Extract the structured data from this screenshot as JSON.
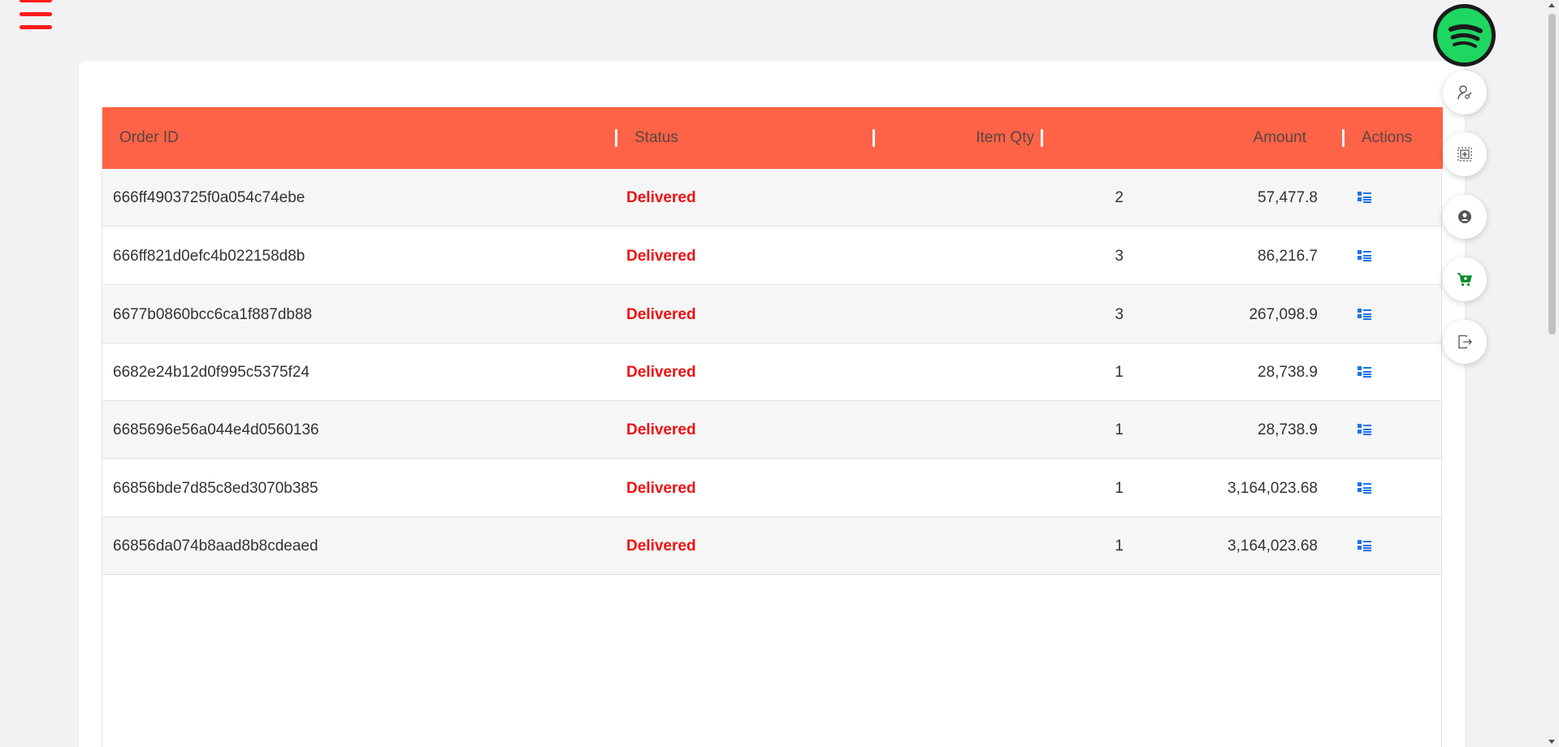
{
  "menu": {
    "icon": "hamburger-menu-icon"
  },
  "table": {
    "headers": {
      "order_id": "Order ID",
      "status": "Status",
      "item_qty": "Item Qty",
      "amount": "Amount",
      "actions": "Actions"
    },
    "rows": [
      {
        "order_id": "666ff4903725f0a054c74ebe",
        "status": "Delivered",
        "qty": "2",
        "amount": "57,477.8"
      },
      {
        "order_id": "666ff821d0efc4b022158d8b",
        "status": "Delivered",
        "qty": "3",
        "amount": "86,216.7"
      },
      {
        "order_id": "6677b0860bcc6ca1f887db88",
        "status": "Delivered",
        "qty": "3",
        "amount": "267,098.9"
      },
      {
        "order_id": "6682e24b12d0f995c5375f24",
        "status": "Delivered",
        "qty": "1",
        "amount": "28,738.9"
      },
      {
        "order_id": "6685696e56a044e4d0560136",
        "status": "Delivered",
        "qty": "1",
        "amount": "28,738.9"
      },
      {
        "order_id": "66856bde7d85c8ed3070b385",
        "status": "Delivered",
        "qty": "1",
        "amount": "3,164,023.68"
      },
      {
        "order_id": "66856da074b8aad8b8cdeaed",
        "status": "Delivered",
        "qty": "1",
        "amount": "3,164,023.68"
      }
    ]
  },
  "sidebar_nav": {
    "items": [
      "spotify-icon",
      "user-edit-icon",
      "add-product-icon",
      "profile-icon",
      "cart-icon",
      "logout-icon"
    ]
  },
  "colors": {
    "header_bg": "#ff6347",
    "status_delivered": "#ee1111",
    "action_icon": "#1a73e8",
    "cart_icon": "#0a8a2a",
    "spotify": "#1ed760"
  }
}
